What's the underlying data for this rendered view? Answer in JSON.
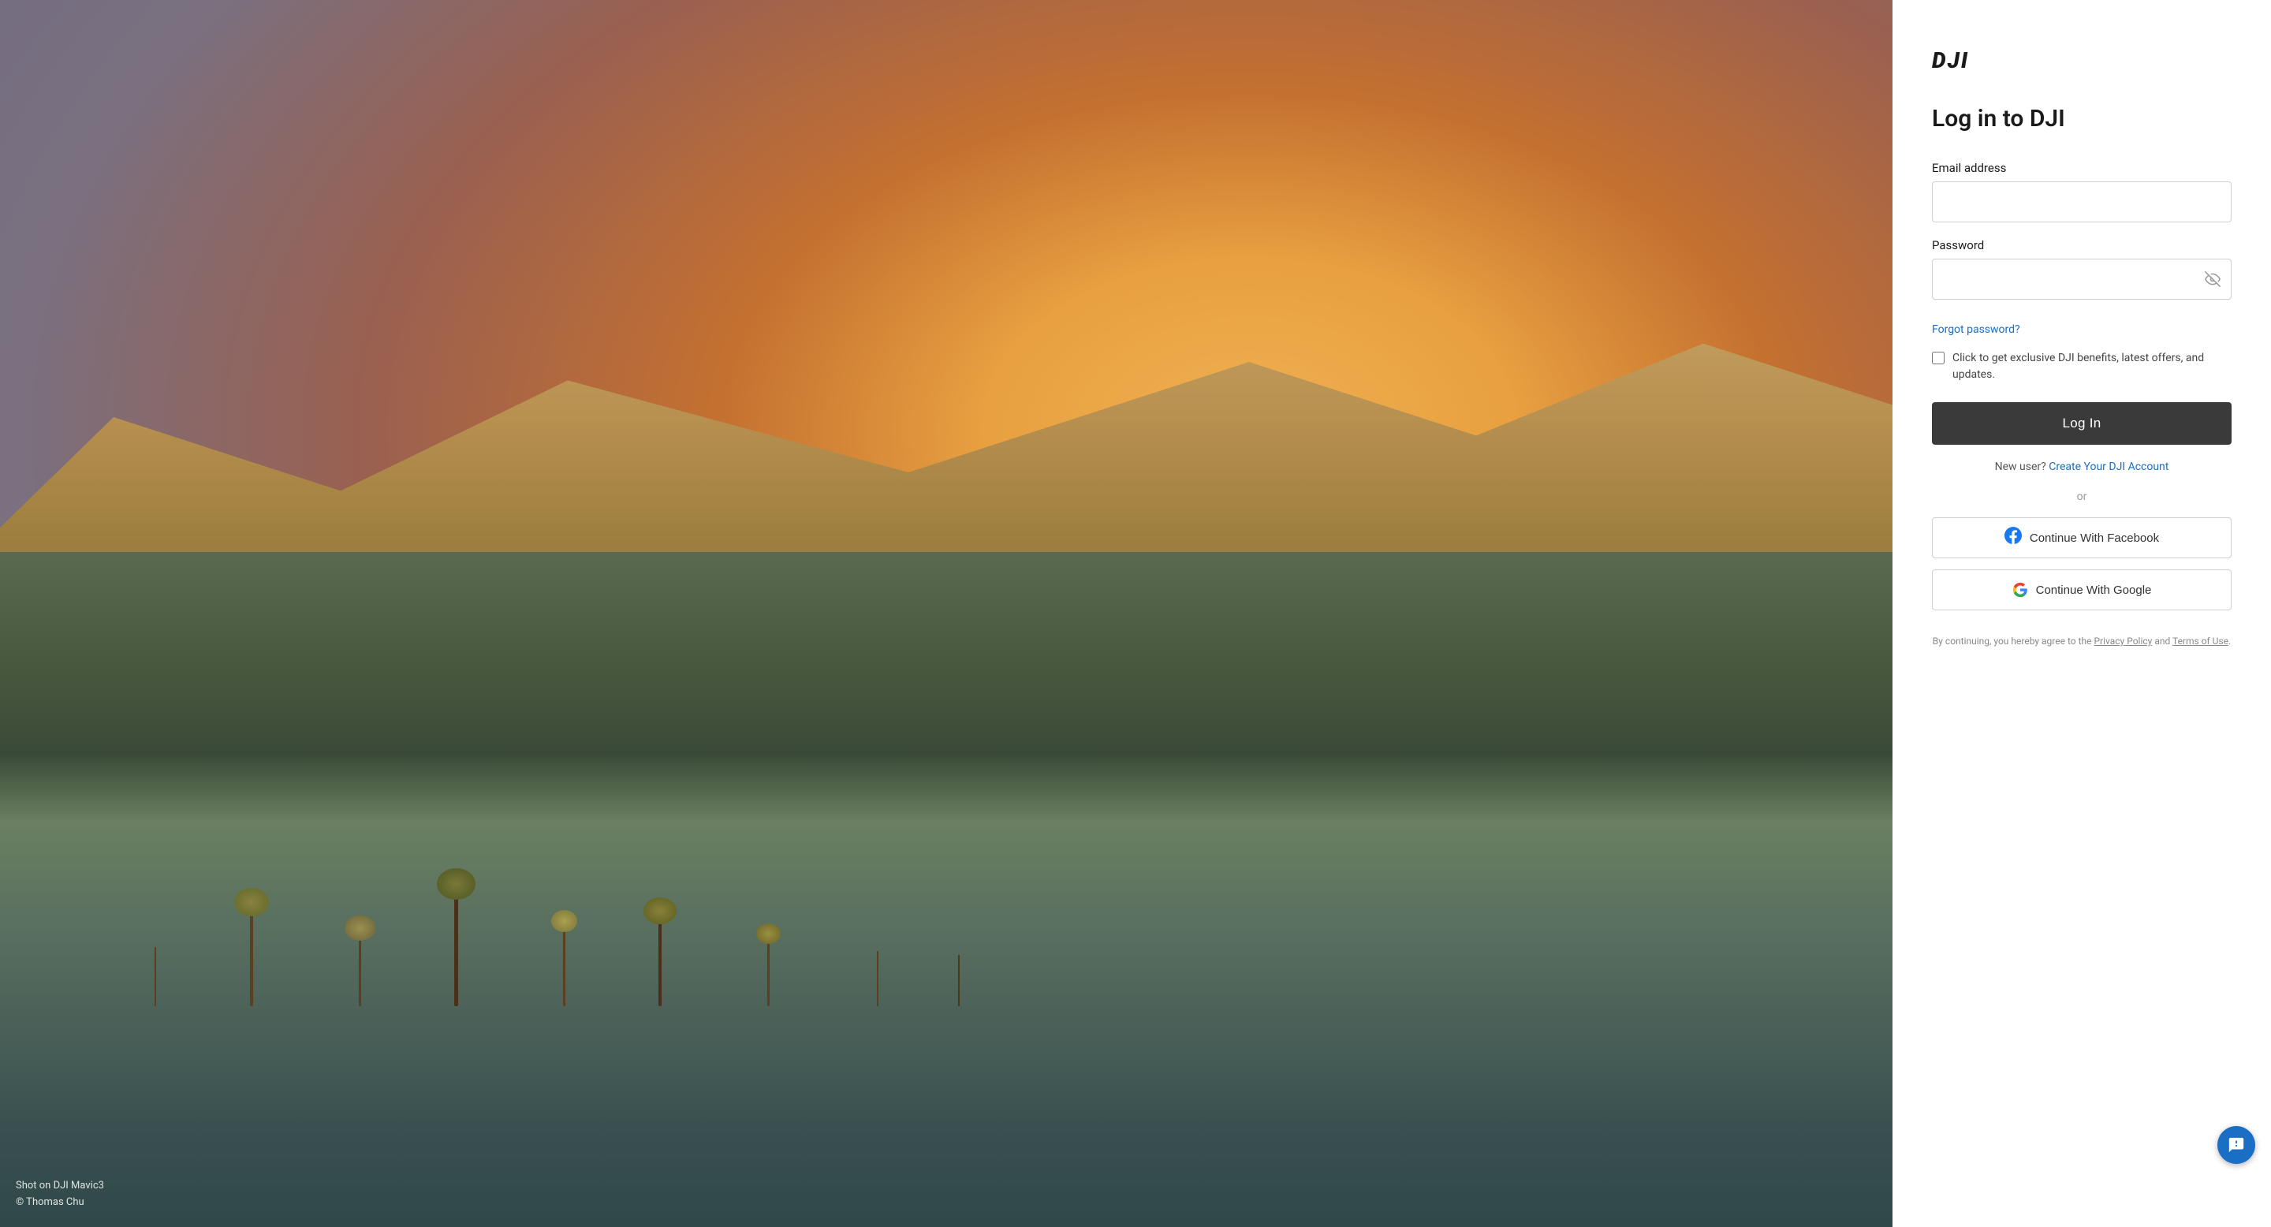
{
  "background": {
    "credit_line1": "Shot on DJI Mavic3",
    "credit_line2": "© Thomas Chu"
  },
  "logo": {
    "text": "DJI"
  },
  "form": {
    "title": "Log in to DJI",
    "email_label": "Email address",
    "email_placeholder": "",
    "password_label": "Password",
    "password_placeholder": "",
    "forgot_password": "Forgot password?",
    "checkbox_label": "Click to get exclusive DJI benefits, latest offers, and updates.",
    "login_button": "Log In",
    "new_user_text": "New user?",
    "create_account_link": "Create Your DJI Account",
    "or_text": "or",
    "facebook_button": "Continue With Facebook",
    "google_button": "Continue With Google",
    "terms_prefix": "By continuing, you hereby agree to the",
    "privacy_policy_link": "Privacy Policy",
    "terms_and": "and",
    "terms_of_use_link": "Terms of Use",
    "terms_suffix": "."
  },
  "support": {
    "icon": "support-icon"
  }
}
